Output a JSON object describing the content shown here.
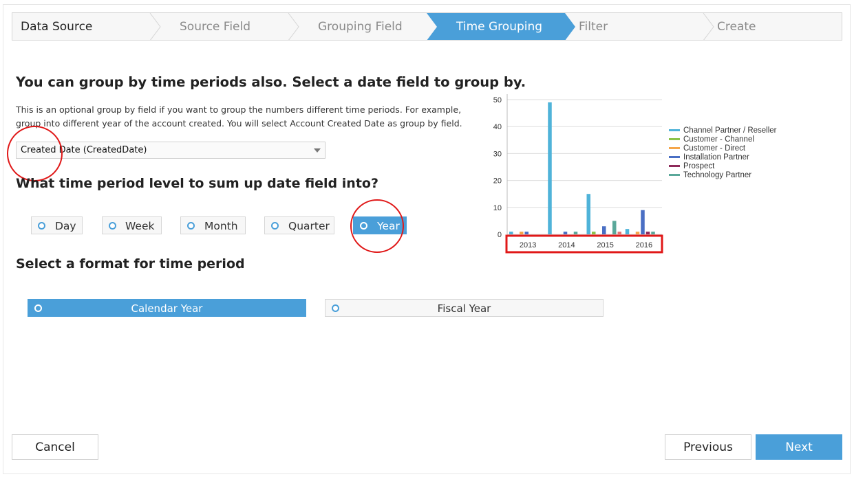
{
  "wizard": {
    "steps": [
      {
        "label": "Data Source"
      },
      {
        "label": "Source Field"
      },
      {
        "label": "Grouping Field"
      },
      {
        "label": "Time Grouping"
      },
      {
        "label": "Filter"
      },
      {
        "label": "Create"
      }
    ],
    "active_index": 3
  },
  "main": {
    "heading": "You can group by time periods also. Select a date field to group by.",
    "description": "This is an optional group by field if you want to group the numbers different time periods. For example, group into different year of the account created. You will select Account Created Date as group by field.",
    "date_field_select": {
      "value": "Created Date (CreatedDate)"
    },
    "period_heading": "What time period level to sum up date field into?",
    "period_options": [
      {
        "label": "Day",
        "selected": false
      },
      {
        "label": "Week",
        "selected": false
      },
      {
        "label": "Month",
        "selected": false
      },
      {
        "label": "Quarter",
        "selected": false
      },
      {
        "label": "Year",
        "selected": true
      }
    ],
    "format_heading": "Select a format for time period",
    "format_options": [
      {
        "label": "Calendar Year",
        "selected": true
      },
      {
        "label": "Fiscal Year",
        "selected": false
      }
    ]
  },
  "footer": {
    "cancel_label": "Cancel",
    "previous_label": "Previous",
    "next_label": "Next"
  },
  "colors": {
    "accent": "#4a9fd9",
    "annotation_red": "#e01818"
  },
  "chart_data": {
    "type": "bar",
    "categories": [
      "2013",
      "2014",
      "2015",
      "2016"
    ],
    "ylim": [
      0,
      50
    ],
    "yticks": [
      0,
      10,
      20,
      30,
      40,
      50
    ],
    "legend_position": "right",
    "series": [
      {
        "name": "Channel Partner / Reseller",
        "color": "#4fb3d9",
        "values": [
          1,
          49,
          15,
          2
        ]
      },
      {
        "name": "Customer - Channel",
        "color": "#8bc34a",
        "values": [
          0,
          0,
          1,
          0
        ]
      },
      {
        "name": "Customer - Direct",
        "color": "#f5a64a",
        "values": [
          1,
          0,
          0,
          1
        ]
      },
      {
        "name": "Installation Partner",
        "color": "#4a6fc4",
        "values": [
          1,
          1,
          3,
          9
        ]
      },
      {
        "name": "Prospect",
        "color": "#8e2a5a",
        "values": [
          0,
          0,
          0,
          1
        ]
      },
      {
        "name": "Technology Partner",
        "color": "#5aa89a",
        "values": [
          0,
          1,
          5,
          1
        ]
      },
      {
        "name": "",
        "color": "#e57373",
        "values": [
          0,
          0,
          1,
          0
        ]
      }
    ],
    "legend_entries": [
      {
        "name": "Channel Partner / Reseller",
        "color": "#4fb3d9"
      },
      {
        "name": "Customer - Channel",
        "color": "#8bc34a"
      },
      {
        "name": "Customer - Direct",
        "color": "#f5a64a"
      },
      {
        "name": "Installation Partner",
        "color": "#4a6fc4"
      },
      {
        "name": "Prospect",
        "color": "#8e2a5a"
      },
      {
        "name": "Technology Partner",
        "color": "#5aa89a"
      }
    ]
  }
}
